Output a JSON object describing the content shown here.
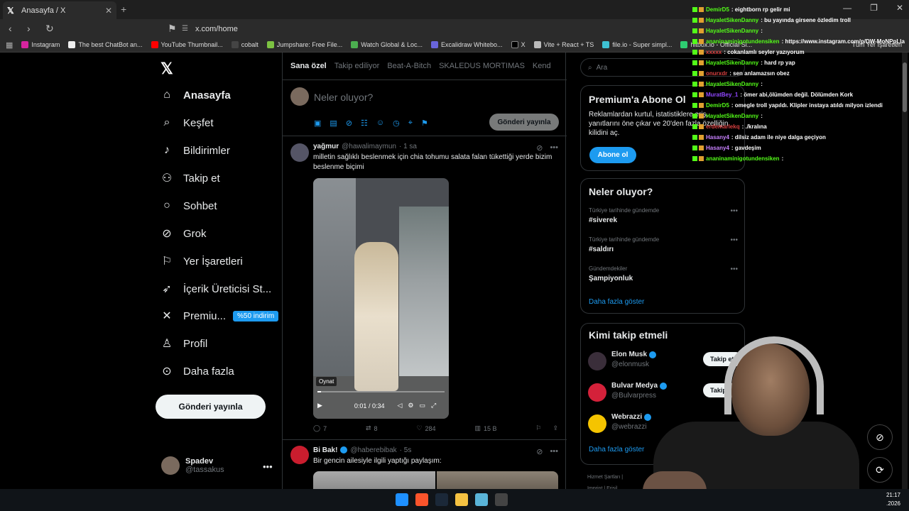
{
  "browser": {
    "tab_title": "Anasayfa / X",
    "url": "x.com/home",
    "bookmarks": [
      "Instagram",
      "The best ChatBot an...",
      "YouTube Thumbnail...",
      "cobalt",
      "Jumpshare: Free File...",
      "Watch Global & Loc...",
      "Excalidraw Whitebo...",
      "X",
      "Vite + React + TS",
      "file.io - Super simpl...",
      "hitbox.io - Official Si..."
    ],
    "all_bookmarks": "Tüm Yer İşaretleri"
  },
  "nav": {
    "items": [
      {
        "label": "Anasayfa",
        "icon": "home-icon"
      },
      {
        "label": "Keşfet",
        "icon": "search-icon"
      },
      {
        "label": "Bildirimler",
        "icon": "bell-icon"
      },
      {
        "label": "Takip et",
        "icon": "add-user-icon"
      },
      {
        "label": "Sohbet",
        "icon": "chat-icon"
      },
      {
        "label": "Grok",
        "icon": "grok-icon"
      },
      {
        "label": "Yer İşaretleri",
        "icon": "bookmark-icon"
      },
      {
        "label": "İçerik Üreticisi St...",
        "icon": "rocket-icon"
      },
      {
        "label": "Premiu...",
        "icon": "x-icon"
      },
      {
        "label": "Profil",
        "icon": "person-icon"
      },
      {
        "label": "Daha fazla",
        "icon": "more-circle-icon"
      }
    ],
    "premium_badge": "%50 indirim",
    "post_button": "Gönderi yayınla"
  },
  "profile": {
    "name": "Spadev",
    "handle": "@tassakus"
  },
  "feed": {
    "tabs": [
      "Sana özel",
      "Takip ediliyor",
      "Beat-A-Bitch",
      "SKALEDUS MORTIMAS",
      "Kend"
    ],
    "compose_placeholder": "Neler oluyor?",
    "compose_button": "Gönderi yayınla",
    "tweet1": {
      "name": "yağmur",
      "handle": "@hawalimaymun",
      "time": "· 1 sa",
      "text": "milletin sağlıklı beslenmek için chia tohumu salata falan tükettiği yerde bizim beslenme biçimi",
      "video_tooltip": "Oynat",
      "video_time": "0:01 / 0:34",
      "video_progress": 0.03,
      "replies": "7",
      "reposts": "8",
      "likes": "284",
      "views": "15 B"
    },
    "tweet2": {
      "name": "Bi Bak!",
      "handle": "@haberebibak",
      "time": "· 5s",
      "text": "Bir gencin ailesiyle ilgili yaptığı paylaşım:"
    }
  },
  "sidebar": {
    "search_placeholder": "Ara",
    "premium": {
      "title": "Premium'a Abone Ol",
      "desc": "Reklamlardan kurtul, istatistiklere eriş, yanıtlarını öne çıkar ve 20'den fazla özelliğin kilidini aç.",
      "button": "Abone ol"
    },
    "trends": {
      "title": "Neler oluyor?",
      "items": [
        {
          "context": "Türkiye tarihinde gündemde",
          "tag": "#siverek"
        },
        {
          "context": "Türkiye tarihinde gündemde",
          "tag": "#saldırı"
        },
        {
          "context": "Gündemdekiler",
          "tag": "Şampiyonluk"
        }
      ],
      "show_more": "Daha fazla göster"
    },
    "who_to_follow": {
      "title": "Kimi takip etmeli",
      "accounts": [
        {
          "name": "Elon Musk",
          "handle": "@elonmusk",
          "button": "Takip et",
          "color": "#3a2e3a"
        },
        {
          "name": "Bulvar Medya",
          "handle": "@Bulvarpress",
          "button": "Takip et",
          "color": "#d4213a"
        },
        {
          "name": "Webrazzi",
          "handle": "@webrazzi",
          "button": "Takip et",
          "color": "#f5c400"
        }
      ],
      "show_more": "Daha fazla göster"
    },
    "footer": [
      "Hizmet Şartları",
      "Imprint",
      "Erişil..."
    ]
  },
  "chat": [
    {
      "user": "DemirD5",
      "color": "#53fc18",
      "msg": ": eightborn rp gelir mi"
    },
    {
      "user": "HayaletSikenDanny",
      "color": "#53fc18",
      "msg": ": bu yayında girsene özledim troll"
    },
    {
      "user": "HayaletSikenDanny",
      "color": "#53fc18",
      "msg": ":"
    },
    {
      "user": "ananinaminigotundensiken",
      "color": "#53fc18",
      "msg": ": https://www.instagram.com/p/DW-MoNPpLla"
    },
    {
      "user": "xxxxx",
      "color": "#d94040",
      "msg": ": cokanlamlı seyler yazıyorum"
    },
    {
      "user": "HayaletSikenDanny",
      "color": "#53fc18",
      "msg": ": hard rp yap"
    },
    {
      "user": "onurxdr",
      "color": "#d94040",
      "msg": ": sen anlamazsın obez"
    },
    {
      "user": "HayaletSikenDanny",
      "color": "#53fc18",
      "msg": ":"
    },
    {
      "user": "MuratBey_1",
      "color": "#9147ff",
      "msg": ": ömer abi,ölümden değil. Dölümden Kork"
    },
    {
      "user": "DemirD5",
      "color": "#53fc18",
      "msg": ": omegle troll yapıldı. Klipler instaya atıldı milyon izlendi"
    },
    {
      "user": "HayaletSikenDanny",
      "color": "#53fc18",
      "msg": ":"
    },
    {
      "user": "erdemarlekq",
      "color": "#d94040",
      "msg": ": ./kralına"
    },
    {
      "user": "Hasany4",
      "color": "#c982ff",
      "msg": ": dilsiz adam ile niye dalga geçiyon"
    },
    {
      "user": "Hasany4",
      "color": "#c982ff",
      "msg": ": gavdeşim"
    },
    {
      "user": "ananinaminigotundensiken",
      "color": "#53fc18",
      "msg": ":"
    }
  ],
  "tray": {
    "time": "21:17",
    "date": ".2026"
  }
}
